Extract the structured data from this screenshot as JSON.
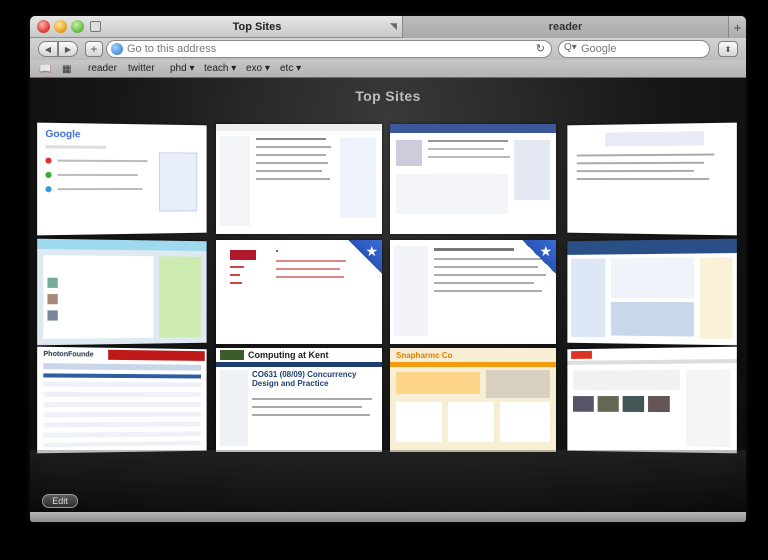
{
  "window": {
    "tabs": [
      {
        "label": "Top Sites",
        "active": true
      },
      {
        "label": "reader",
        "active": false
      }
    ]
  },
  "toolbar": {
    "address_placeholder": "Go to this address",
    "search_placeholder": "Google"
  },
  "bookmarks": {
    "items": [
      "reader",
      "twitter",
      "phd ▾",
      "teach ▾",
      "exo ▾",
      "etc ▾"
    ]
  },
  "content": {
    "title": "Top Sites",
    "edit_label": "Edit"
  },
  "tiles": [
    {
      "name": "google",
      "starred": false
    },
    {
      "name": "mail-list",
      "starred": false
    },
    {
      "name": "facebook",
      "starred": false
    },
    {
      "name": "plain-page",
      "starred": false
    },
    {
      "name": "twitter",
      "starred": false
    },
    {
      "name": "kent-red-page",
      "starred": true
    },
    {
      "name": "wiki-page",
      "starred": true
    },
    {
      "name": "travel-site",
      "starred": false
    },
    {
      "name": "photo-site",
      "starred": false
    },
    {
      "name": "computing-at-kent",
      "starred": false
    },
    {
      "name": "snapshot-site",
      "starred": false
    },
    {
      "name": "youtube",
      "starred": false
    }
  ],
  "tile_texts": {
    "google_logo": "Google",
    "kent_heading": "Computing at Kent",
    "kent_course": "CO631 (08/09) Concurrency Design and Practice",
    "photo_logo": "PhotonFounde",
    "snap_logo": "Snapharmc Co"
  },
  "colors": {
    "window_bg": "#1a1a1a",
    "accent_blue": "#2a55b8"
  }
}
